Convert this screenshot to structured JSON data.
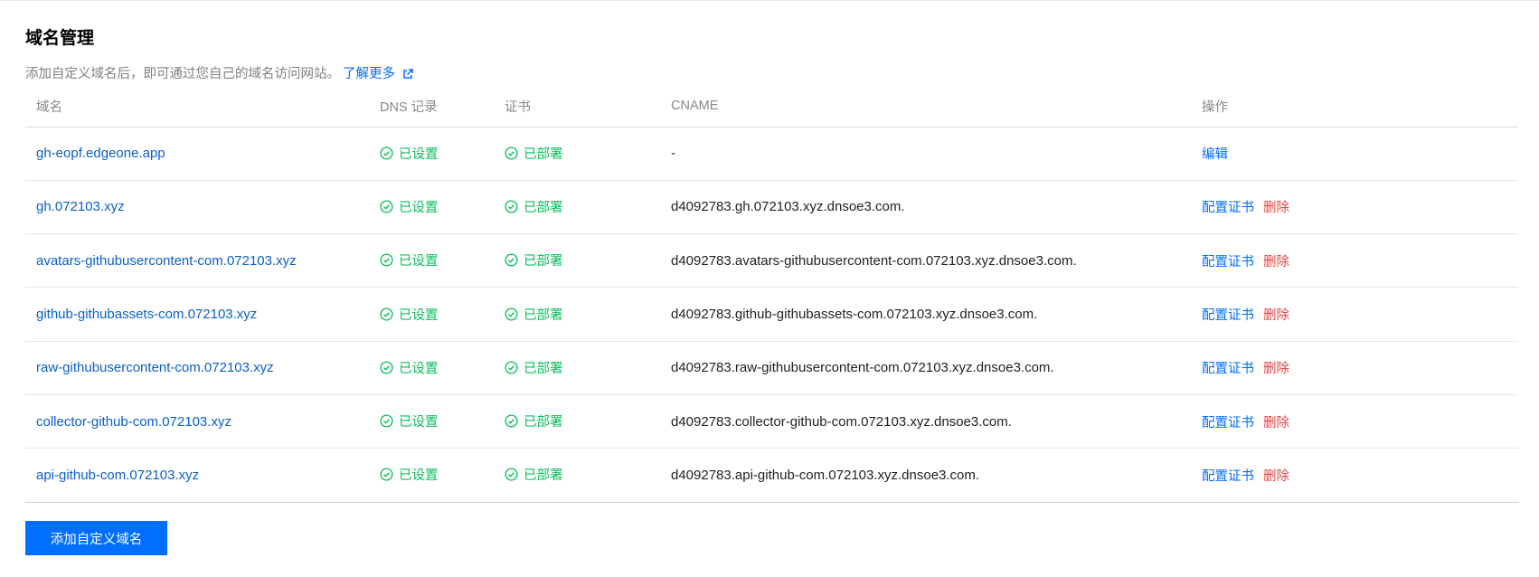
{
  "header": {
    "title": "域名管理",
    "description": "添加自定义域名后，即可通过您自己的域名访问网站。",
    "learn_more": "了解更多"
  },
  "table": {
    "columns": {
      "domain": "域名",
      "dns": "DNS 记录",
      "cert": "证书",
      "cname": "CNAME",
      "actions": "操作"
    },
    "rows": [
      {
        "domain": "gh-eopf.edgeone.app",
        "dns": "已设置",
        "cert": "已部署",
        "cname": "-",
        "action1": "编辑",
        "action2": ""
      },
      {
        "domain": "gh.072103.xyz",
        "dns": "已设置",
        "cert": "已部署",
        "cname": "d4092783.gh.072103.xyz.dnsoe3.com.",
        "action1": "配置证书",
        "action2": "删除"
      },
      {
        "domain": "avatars-githubusercontent-com.072103.xyz",
        "dns": "已设置",
        "cert": "已部署",
        "cname": "d4092783.avatars-githubusercontent-com.072103.xyz.dnsoe3.com.",
        "action1": "配置证书",
        "action2": "删除"
      },
      {
        "domain": "github-githubassets-com.072103.xyz",
        "dns": "已设置",
        "cert": "已部署",
        "cname": "d4092783.github-githubassets-com.072103.xyz.dnsoe3.com.",
        "action1": "配置证书",
        "action2": "删除"
      },
      {
        "domain": "raw-githubusercontent-com.072103.xyz",
        "dns": "已设置",
        "cert": "已部署",
        "cname": "d4092783.raw-githubusercontent-com.072103.xyz.dnsoe3.com.",
        "action1": "配置证书",
        "action2": "删除"
      },
      {
        "domain": "collector-github-com.072103.xyz",
        "dns": "已设置",
        "cert": "已部署",
        "cname": "d4092783.collector-github-com.072103.xyz.dnsoe3.com.",
        "action1": "配置证书",
        "action2": "删除"
      },
      {
        "domain": "api-github-com.072103.xyz",
        "dns": "已设置",
        "cert": "已部署",
        "cname": "d4092783.api-github-com.072103.xyz.dnsoe3.com.",
        "action1": "配置证书",
        "action2": "删除"
      }
    ]
  },
  "footer": {
    "add_button": "添加自定义域名"
  },
  "colors": {
    "accent": "#006eff",
    "success": "#0abf5b",
    "danger": "#e54545",
    "domain_link": "#0b5fc8"
  },
  "icons": {
    "status": "check-circle-icon",
    "external": "external-link-icon"
  }
}
